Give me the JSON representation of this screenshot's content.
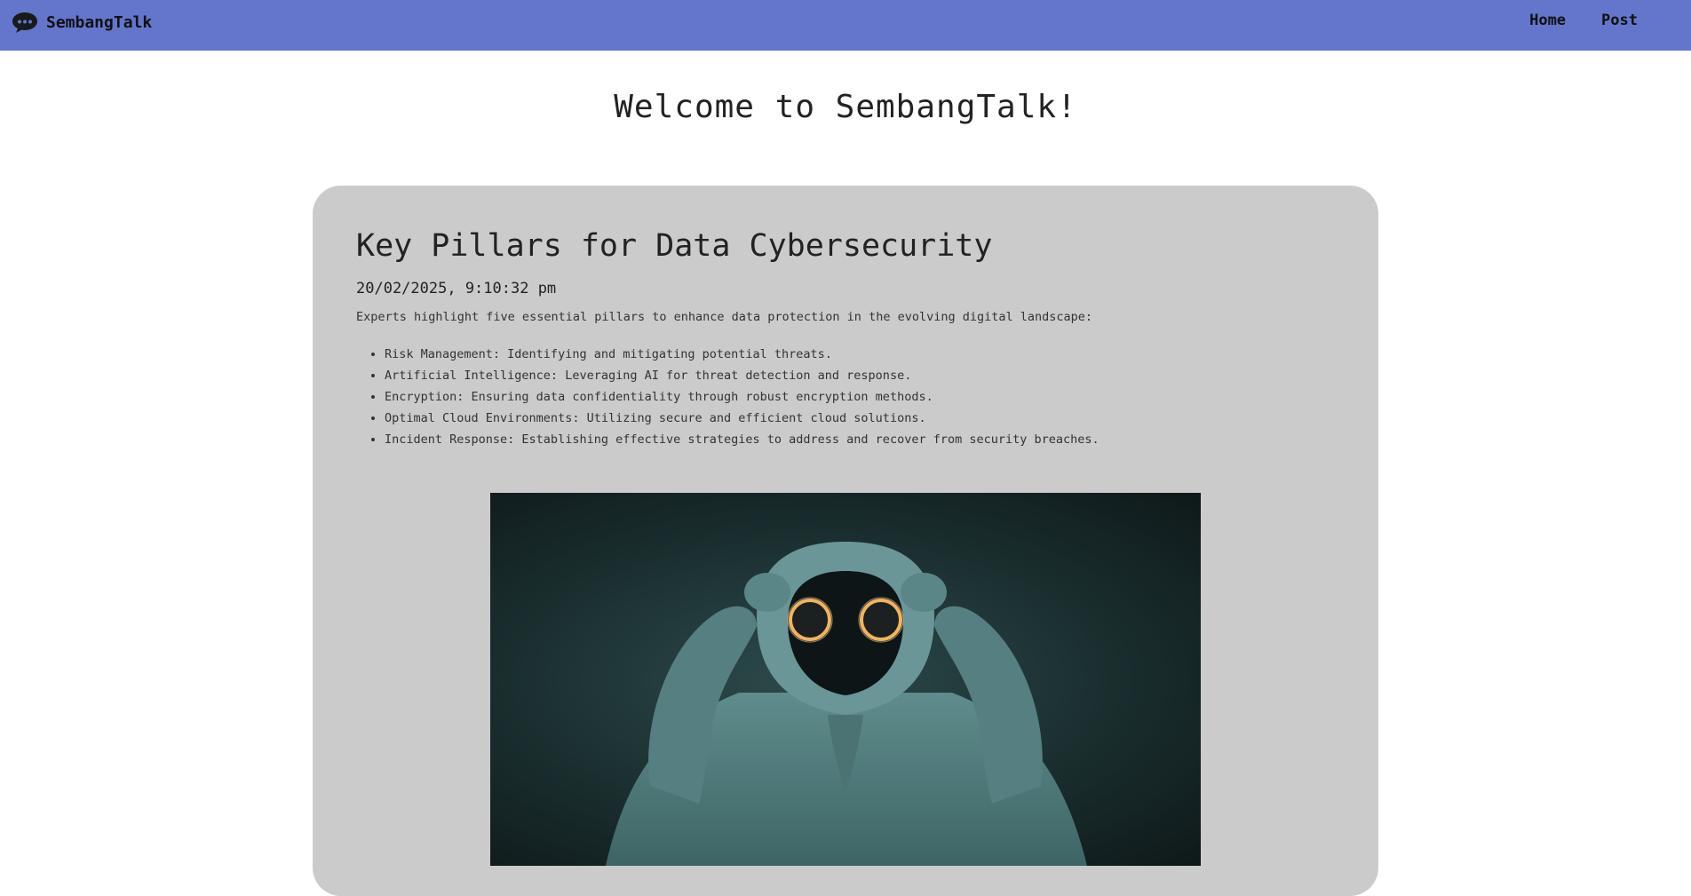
{
  "navbar": {
    "brand_name": "SembangTalk",
    "links": [
      {
        "label": "Home"
      },
      {
        "label": "Post"
      }
    ],
    "background_color": "#6476cb"
  },
  "page": {
    "heading": "Welcome to SembangTalk!"
  },
  "post": {
    "title": "Key Pillars for Data Cybersecurity",
    "date": "20/02/2025, 9:10:32 pm",
    "intro": "Experts highlight five essential pillars to enhance data protection in the evolving digital landscape:",
    "pillars": [
      "Risk Management: Identifying and mitigating potential threats.",
      "Artificial Intelligence: Leveraging AI for threat detection and response.",
      "Encryption: Ensuring data confidentiality through robust encryption methods.",
      "Optimal Cloud Environments: Utilizing secure and efficient cloud solutions.",
      "Incident Response: Establishing effective strategies to address and recover from security breaches."
    ],
    "image_icon": "hooded-figure-glowing-eyes",
    "card_color": "#cbcbcb"
  }
}
